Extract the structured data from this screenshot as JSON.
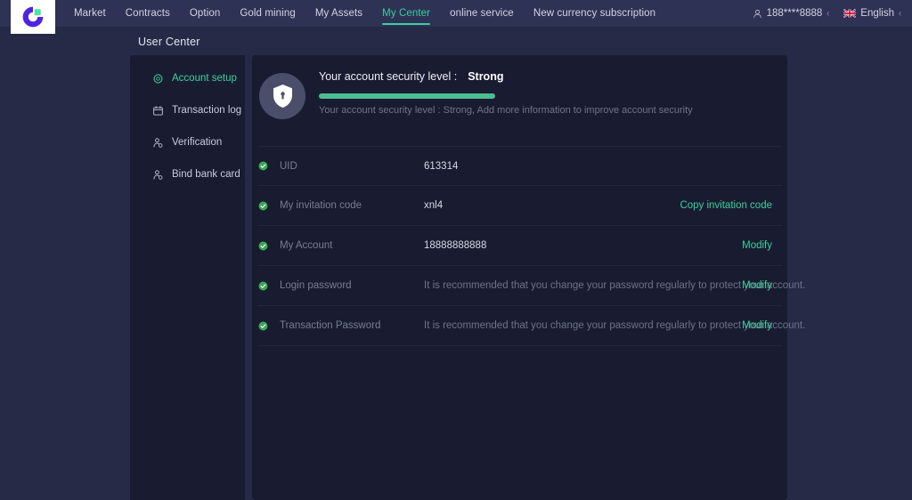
{
  "header": {
    "logo_name": "brand-logo",
    "nav": [
      {
        "label": "Market",
        "active": false
      },
      {
        "label": "Contracts",
        "active": false
      },
      {
        "label": "Option",
        "active": false
      },
      {
        "label": "Gold mining",
        "active": false
      },
      {
        "label": "My Assets",
        "active": false
      },
      {
        "label": "My Center",
        "active": true
      },
      {
        "label": "online service",
        "active": false
      },
      {
        "label": "New currency subscription",
        "active": false
      }
    ],
    "account_label": "188****8888",
    "language_label": "English",
    "caret_glyph": "‹"
  },
  "page": {
    "title": "User Center"
  },
  "sidebar": {
    "items": [
      {
        "label": "Account setup",
        "icon": "gear-icon",
        "active": true
      },
      {
        "label": "Transaction log",
        "icon": "calendar-icon",
        "active": false
      },
      {
        "label": "Verification",
        "icon": "user-check-icon",
        "active": false
      },
      {
        "label": "Bind bank card",
        "icon": "user-card-icon",
        "active": false
      }
    ]
  },
  "security": {
    "icon": "shield-lock-icon",
    "title_prefix": "Your account security level :",
    "level": "Strong",
    "progress_percent": 100,
    "description": "Your account security level : Strong,  Add more information to improve account security"
  },
  "rows": [
    {
      "status_icon": "check-circle-icon",
      "label": "UID",
      "value": "613314",
      "value_muted": false,
      "action": ""
    },
    {
      "status_icon": "check-circle-icon",
      "label": "My invitation code",
      "value": "xnl4",
      "value_muted": false,
      "action": "Copy invitation code"
    },
    {
      "status_icon": "check-circle-icon",
      "label": "My Account",
      "value": "18888888888",
      "value_muted": false,
      "action": "Modify"
    },
    {
      "status_icon": "check-circle-icon",
      "label": "Login password",
      "value": "It is recommended that you change your password regularly to protect your account.",
      "value_muted": true,
      "action": "Modify"
    },
    {
      "status_icon": "check-circle-icon",
      "label": "Transaction Password",
      "value": "It is recommended that you change your password regularly to protect your account.",
      "value_muted": true,
      "action": "Modify"
    }
  ],
  "colors": {
    "accent_green": "#3ecfa0",
    "progress_green": "#4bbd93",
    "header_bg": "#2e3254",
    "page_bg": "#262a47",
    "panel_bg": "#191c30",
    "brand_purple": "#4f24e0"
  }
}
